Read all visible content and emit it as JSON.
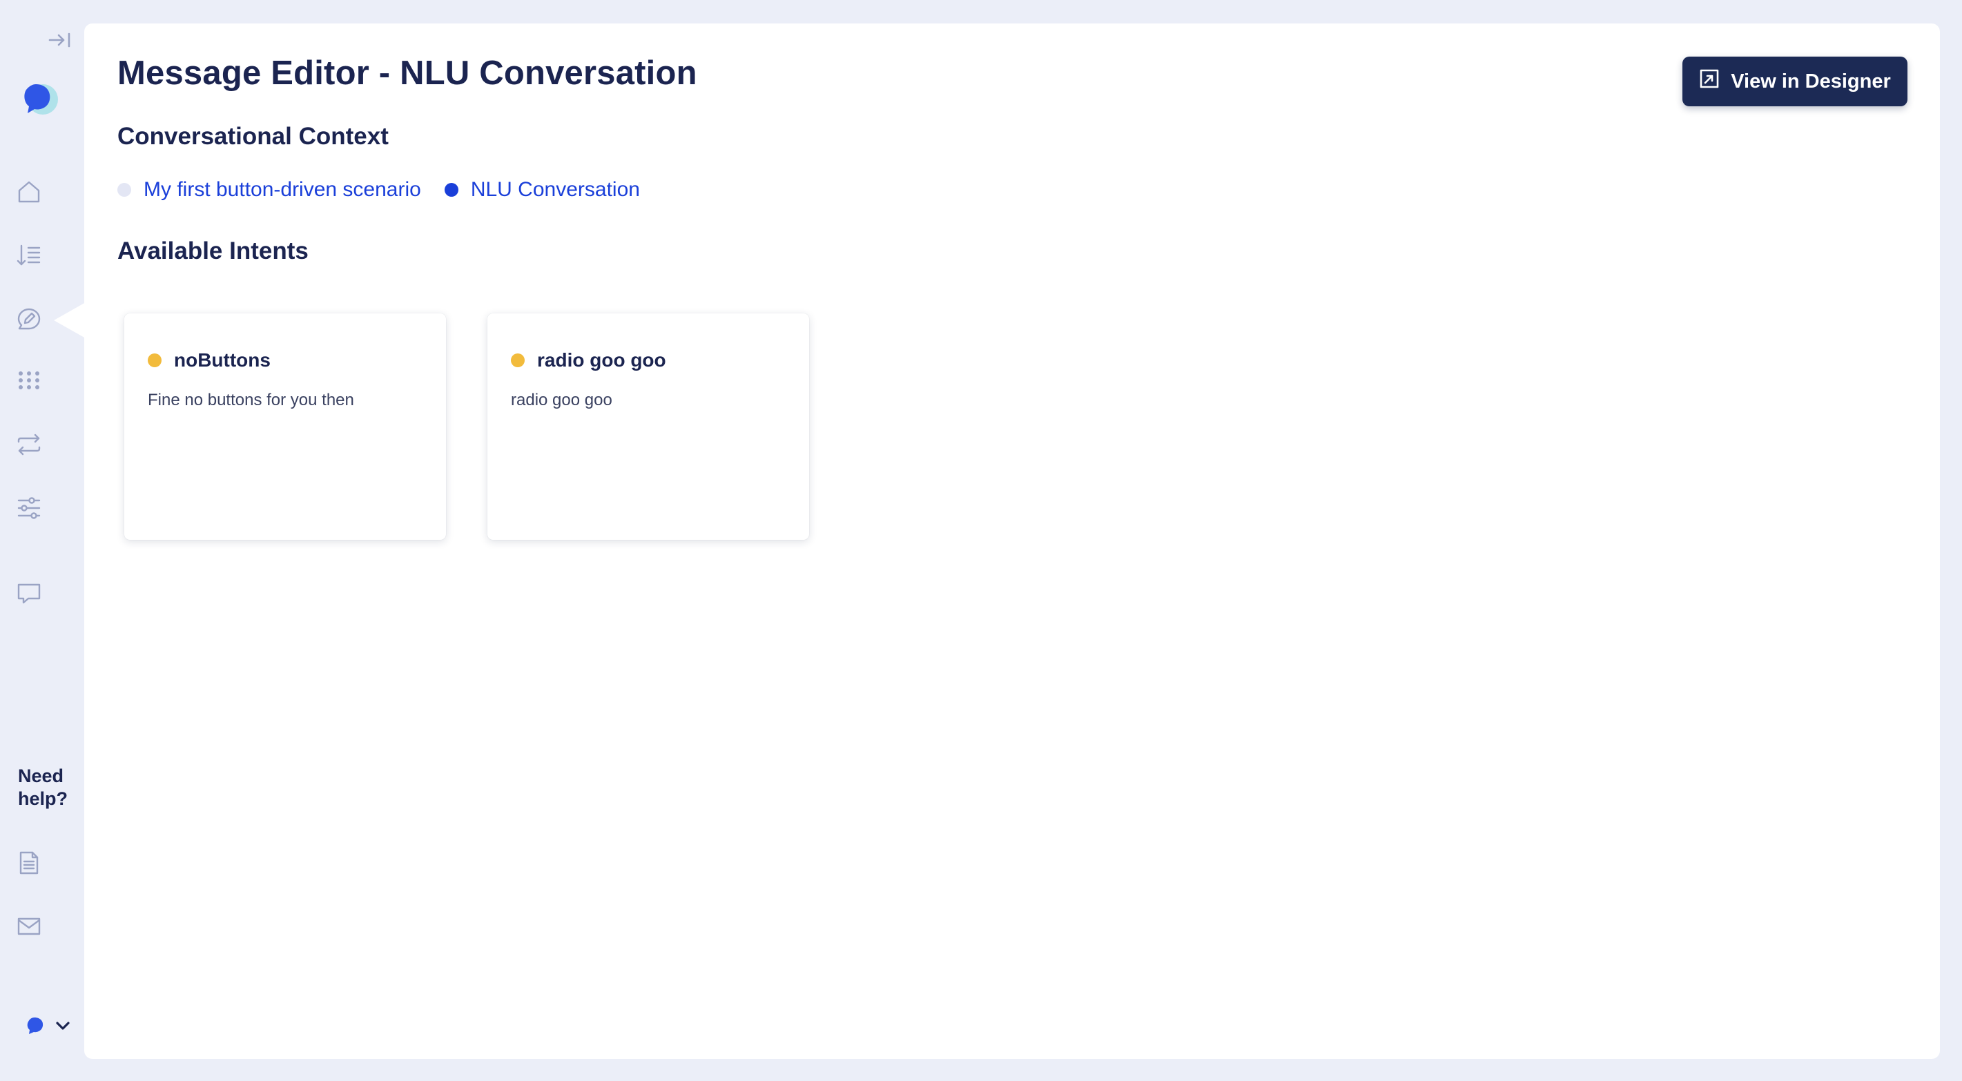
{
  "page": {
    "title": "Message Editor - NLU Conversation",
    "view_designer_label": "View in Designer"
  },
  "context": {
    "heading": "Conversational Context",
    "items": [
      {
        "label": "My first button-driven scenario",
        "dot_color": "#e3e6f4"
      },
      {
        "label": "NLU Conversation",
        "dot_color": "#1a3fd9"
      }
    ]
  },
  "intents": {
    "heading": "Available Intents",
    "items": [
      {
        "name": "noButtons",
        "description": "Fine no buttons for you then",
        "dot_color": "#f2bb3c"
      },
      {
        "name": "radio goo goo",
        "description": "radio goo goo",
        "dot_color": "#f2bb3c"
      }
    ]
  },
  "sidebar": {
    "nav_icons": [
      "home-icon",
      "sort-list-icon",
      "message-editor-icon",
      "apps-grid-icon",
      "repeat-icon",
      "sliders-icon",
      "chat-icon"
    ],
    "active": "message-editor-icon",
    "help_label": "Need help?",
    "help_icons": [
      "document-icon",
      "mail-icon"
    ]
  },
  "colors": {
    "accent": "#1a3fd9",
    "primary_dark": "#1c2a55",
    "background": "#ebeef8",
    "intent_dot": "#f2bb3c"
  }
}
